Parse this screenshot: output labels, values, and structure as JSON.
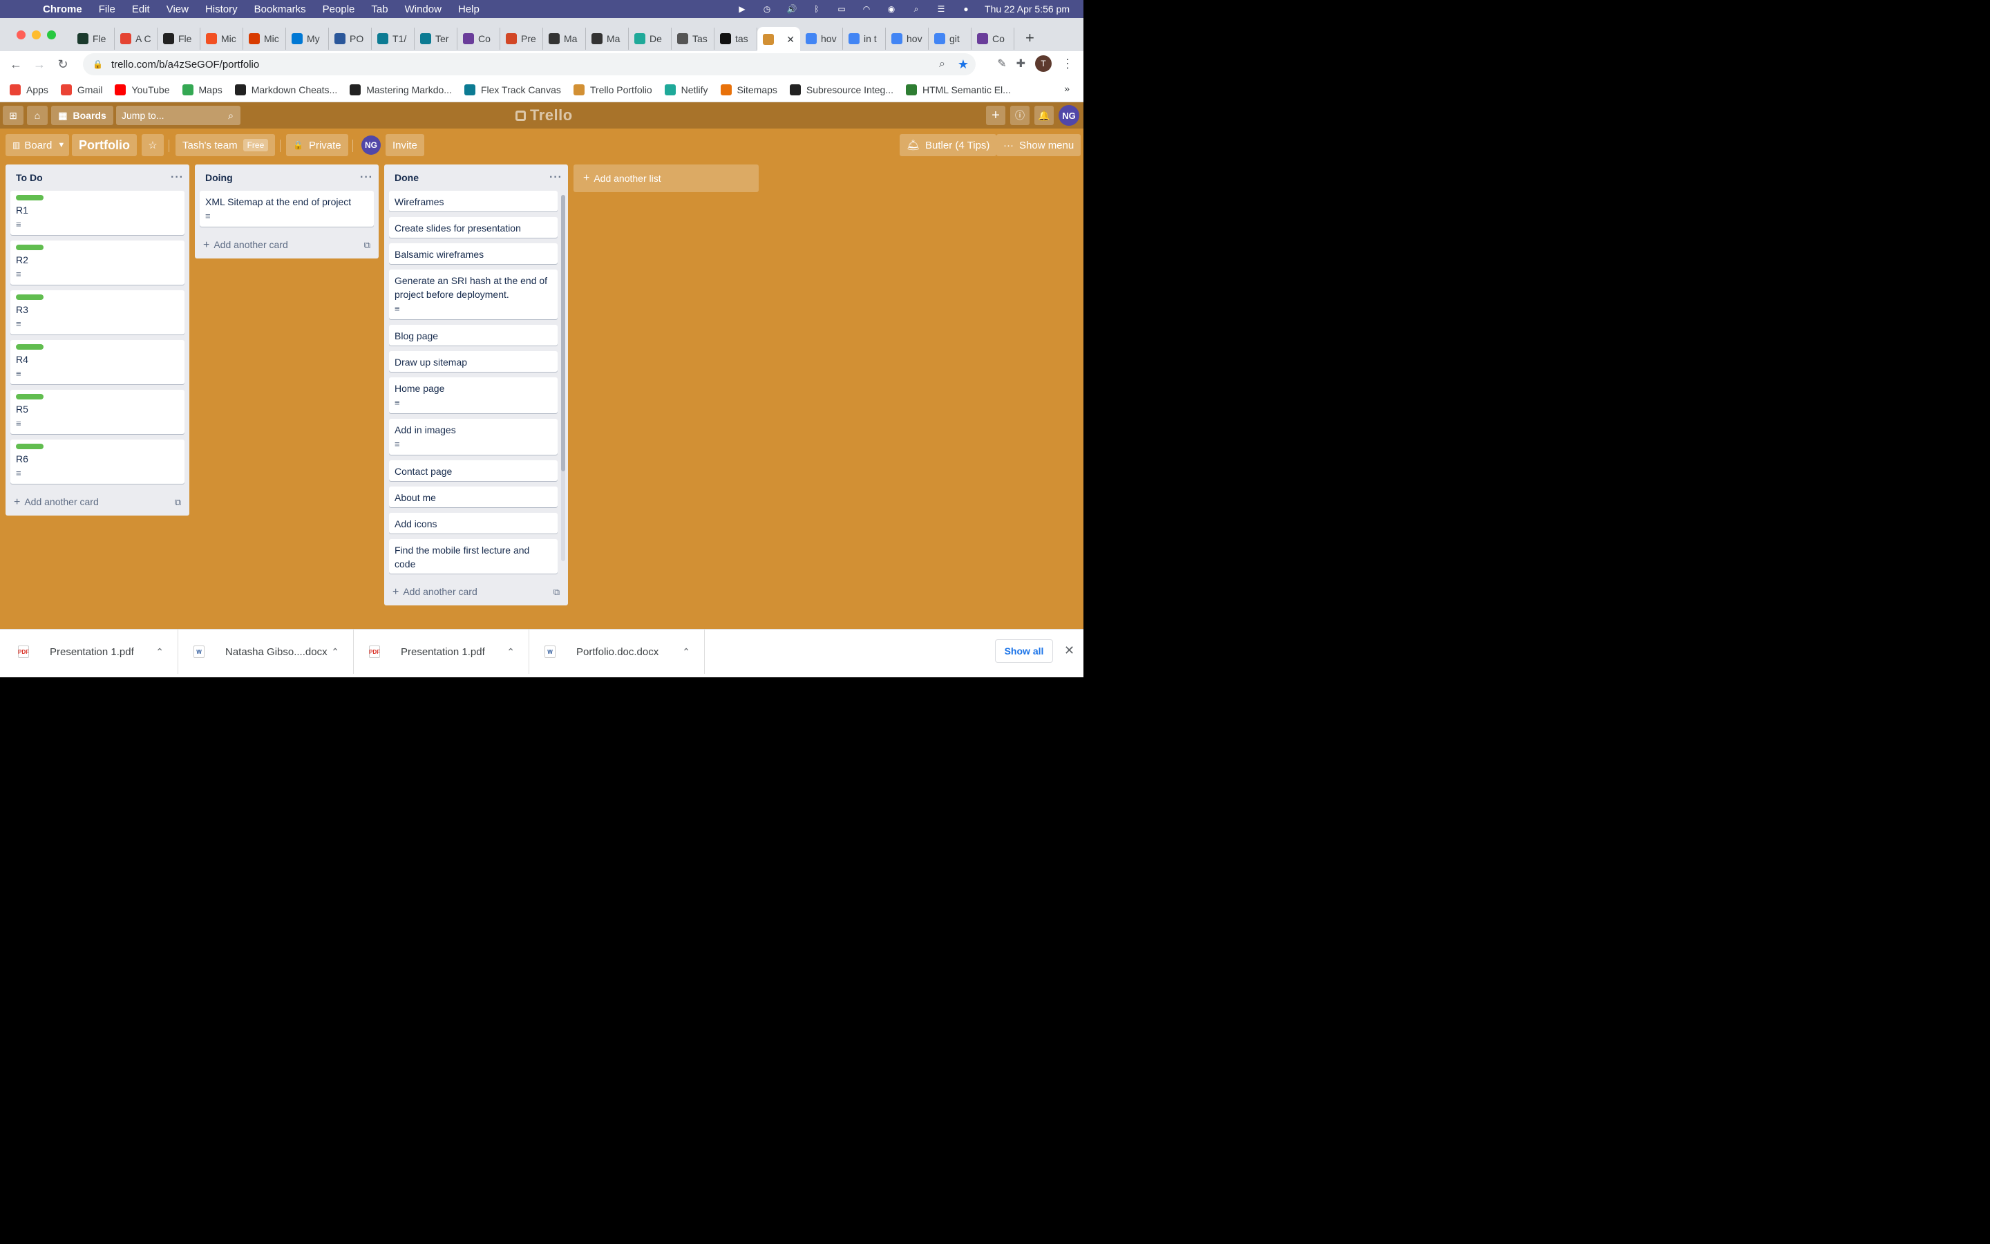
{
  "menubar": {
    "app": "Chrome",
    "items": [
      "File",
      "Edit",
      "View",
      "History",
      "Bookmarks",
      "People",
      "Tab",
      "Window",
      "Help"
    ],
    "datetime": "Thu 22 Apr  5:56 pm"
  },
  "tabs": [
    {
      "title": "Fle",
      "color": "#1b3a2d"
    },
    {
      "title": "A C",
      "color": "#e44332"
    },
    {
      "title": "Fle",
      "color": "#222"
    },
    {
      "title": "Mic",
      "color": "#f25022"
    },
    {
      "title": "Mic",
      "color": "#d83b01"
    },
    {
      "title": "My",
      "color": "#0078d4"
    },
    {
      "title": "PO",
      "color": "#2b579a"
    },
    {
      "title": "T1/",
      "color": "#0c7b93"
    },
    {
      "title": "Ter",
      "color": "#0c7b93"
    },
    {
      "title": "Co",
      "color": "#6a3d9a"
    },
    {
      "title": "Pre",
      "color": "#d24726"
    },
    {
      "title": "Ma",
      "color": "#333"
    },
    {
      "title": "Ma",
      "color": "#333"
    },
    {
      "title": "De",
      "color": "#1fa999"
    },
    {
      "title": "Tas",
      "color": "#555"
    },
    {
      "title": "tas",
      "color": "#111"
    },
    {
      "title": "",
      "color": "#d29034",
      "active": true
    },
    {
      "title": "hov",
      "color": "#4285f4"
    },
    {
      "title": "in t",
      "color": "#4285f4"
    },
    {
      "title": "hov",
      "color": "#4285f4"
    },
    {
      "title": "git",
      "color": "#4285f4"
    },
    {
      "title": "Co",
      "color": "#6a3d9a"
    }
  ],
  "omnibox": {
    "url": "trello.com/b/a4zSeGOF/portfolio"
  },
  "profile_initial": "T",
  "bookmarks": [
    {
      "label": "Apps",
      "color": "#ea4335"
    },
    {
      "label": "Gmail",
      "color": "#ea4335"
    },
    {
      "label": "YouTube",
      "color": "#ff0000"
    },
    {
      "label": "Maps",
      "color": "#34a853"
    },
    {
      "label": "Markdown Cheats...",
      "color": "#222"
    },
    {
      "label": "Mastering Markdo...",
      "color": "#222"
    },
    {
      "label": "Flex Track Canvas",
      "color": "#0c7b93"
    },
    {
      "label": "Trello Portfolio",
      "color": "#d29034"
    },
    {
      "label": "Netlify",
      "color": "#1fa999"
    },
    {
      "label": "Sitemaps",
      "color": "#e8710a"
    },
    {
      "label": "Subresource Integ...",
      "color": "#222"
    },
    {
      "label": "HTML Semantic El...",
      "color": "#2e7d32"
    }
  ],
  "bookmarks_more": "»",
  "trello": {
    "boards_label": "Boards",
    "search_placeholder": "Jump to...",
    "logo": "Trello",
    "avatar": "NG",
    "board_view": "Board",
    "board_title": "Portfolio",
    "team": "Tash's team",
    "team_badge": "Free",
    "visibility": "Private",
    "invite": "Invite",
    "butler": "Butler (4 Tips)",
    "show_menu": "Show menu",
    "add_list": "Add another list",
    "add_card": "Add another card",
    "accent": "#d29034"
  },
  "lists": [
    {
      "title": "To Do",
      "cards": [
        "R1",
        "R2",
        "R3",
        "R4",
        "R5",
        "R6"
      ]
    },
    {
      "title": "Doing",
      "cards": [
        "XML Sitemap at the end of project"
      ]
    },
    {
      "title": "Done",
      "cards": [
        "Wireframes",
        "Create slides for presentation",
        "Balsamic wireframes",
        "Generate an SRI hash at the end of project before deployment.",
        "Blog page",
        "Draw up sitemap",
        "Home page",
        "Add in images",
        "Contact page",
        "About me",
        "Add icons",
        "Find the mobile first lecture and code"
      ]
    }
  ],
  "downloads": [
    {
      "name": "Presentation 1.pdf",
      "type": "pdf"
    },
    {
      "name": "Natasha Gibso....docx",
      "type": "docx"
    },
    {
      "name": "Presentation 1.pdf",
      "type": "pdf"
    },
    {
      "name": "Portfolio.doc.docx",
      "type": "docx"
    }
  ],
  "show_all": "Show all"
}
